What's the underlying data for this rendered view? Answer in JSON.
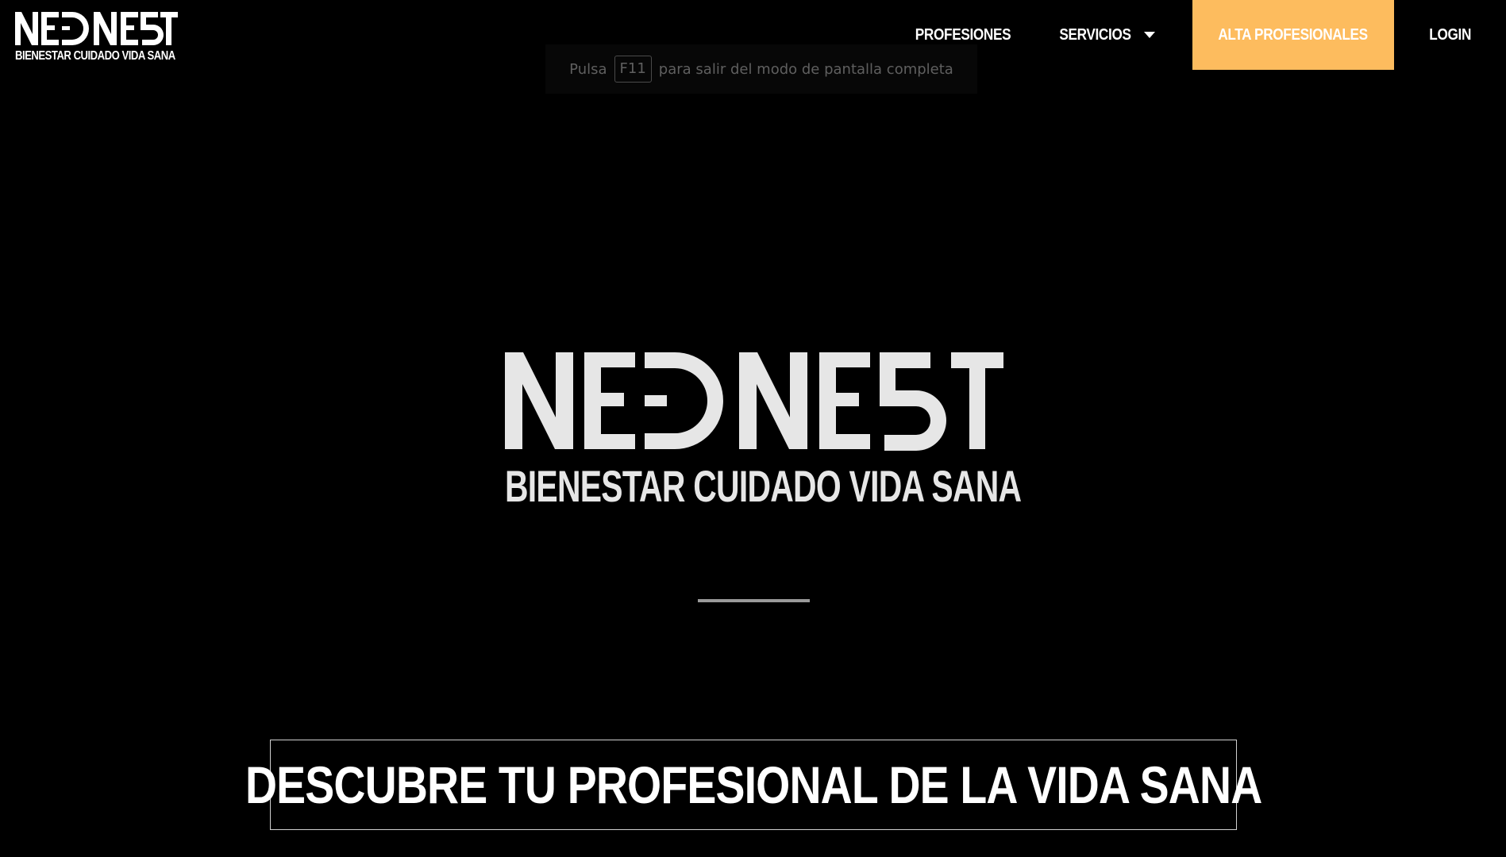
{
  "brand": {
    "name": "NEDNEST",
    "tagline": "BIENESTAR CUIDADO VIDA SANA"
  },
  "nav": {
    "items": [
      {
        "label": "PROFESIONES"
      },
      {
        "label": "SERVICIOS"
      },
      {
        "label": "ALTA PROFESIONALES"
      },
      {
        "label": "LOGIN"
      }
    ]
  },
  "fullscreen_notice": {
    "prefix": "Pulsa",
    "key": "F11",
    "suffix": "para salir del modo de pantalla completa"
  },
  "hero": {
    "cta": "DESCUBRE TU PROFESIONAL DE LA VIDA SANA"
  },
  "colors": {
    "background": "#000000",
    "accent": "#FDBC5E",
    "text": "#FFFFFF"
  }
}
